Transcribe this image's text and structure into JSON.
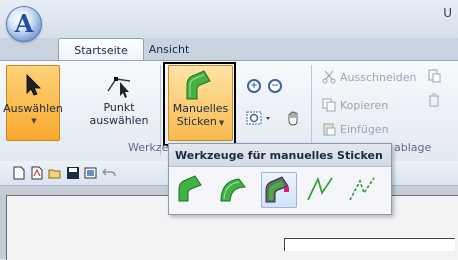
{
  "window": {
    "title_partial": "U"
  },
  "app_button": {
    "letter": "A"
  },
  "tabs": [
    {
      "label": "Startseite",
      "active": true
    },
    {
      "label": "Ansicht",
      "active": false
    }
  ],
  "ribbon": {
    "select_button": {
      "label_line1": "Auswählen",
      "has_dropdown": true
    },
    "point_select_button": {
      "label_line1": "Punkt",
      "label_line2": "auswählen"
    },
    "manual_stitch_button": {
      "label_line1": "Manuelles",
      "label_line2": "Sticken",
      "has_dropdown": true
    },
    "group_label_tools": "Werkze",
    "group_label_clipboard": "ablage",
    "clipboard": {
      "cut": "Ausschneiden",
      "copy": "Kopieren",
      "paste": "Einfügen"
    }
  },
  "dropdown": {
    "title": "Werkzeuge für manuelles Sticken",
    "tools": [
      {
        "icon": "manual-fill-icon"
      },
      {
        "icon": "manual-curve-fill-icon"
      },
      {
        "icon": "manual-point-fill-icon"
      },
      {
        "icon": "manual-line-icon"
      },
      {
        "icon": "manual-dashed-line-icon"
      }
    ]
  },
  "colors": {
    "accent_orange": "#f7a92d",
    "stitch_green": "#3fae3f",
    "dark_green": "#2e7d2e",
    "magenta": "#e0168a"
  }
}
